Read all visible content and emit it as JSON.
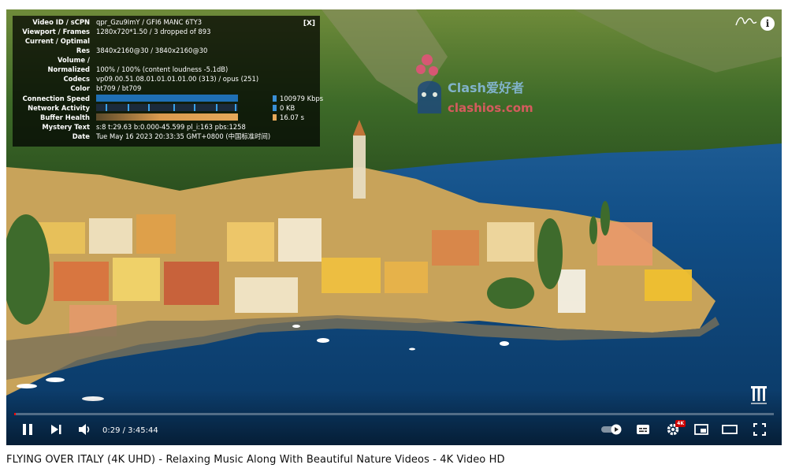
{
  "stats": {
    "close_label": "[X]",
    "rows": [
      {
        "label": "Video ID / sCPN",
        "value": "qpr_Gzu9ImY / GFI6 MANC 6TY3"
      },
      {
        "label": "Viewport / Frames",
        "value": "1280x720*1.50 / 3 dropped of 893"
      },
      {
        "label": "Current / Optimal",
        "value": ""
      },
      {
        "label": "Res",
        "value": "3840x2160@30 / 3840x2160@30"
      },
      {
        "label": "Volume /",
        "value": ""
      },
      {
        "label": "Normalized",
        "value": "100% / 100% (content loudness -5.1dB)"
      },
      {
        "label": "Codecs",
        "value": "vp09.00.51.08.01.01.01.01.00 (313) / opus (251)"
      },
      {
        "label": "Color",
        "value": "bt709 / bt709"
      }
    ],
    "connection_speed": {
      "label": "Connection Speed",
      "value": "100979 Kbps"
    },
    "network_activity": {
      "label": "Network Activity",
      "value": "0 KB"
    },
    "buffer_health": {
      "label": "Buffer Health",
      "value": "16.07 s"
    },
    "mystery_text": {
      "label": "Mystery Text",
      "value": "s:8 t:29.63 b:0.000-45.599 pl_i:163 pbs:1258"
    },
    "date": {
      "label": "Date",
      "value": "Tue May 16 2023 20:33:35 GMT+0800 (中国标准时间)"
    }
  },
  "watermark": {
    "line1": "Clash爱好者",
    "line2": "clashios.com"
  },
  "controls": {
    "time_display": "0:29 / 3:45:44",
    "progress_fraction": 0.0022,
    "settings_badge": "4K"
  },
  "video_title": "FLYING OVER ITALY (4K UHD) - Relaxing Music Along With Beautiful Nature Videos - 4K Video HD",
  "colors": {
    "progress": "#ff0000",
    "badge": "#cc0000",
    "water": "#0f4f86"
  }
}
